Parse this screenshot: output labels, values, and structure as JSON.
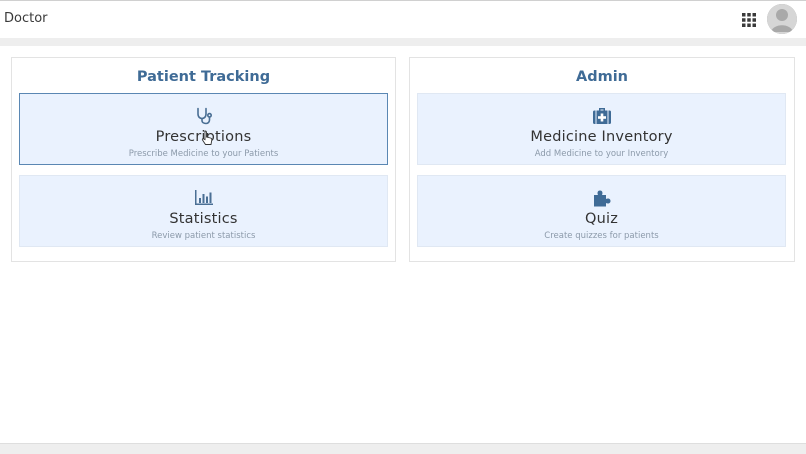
{
  "header": {
    "title": "Doctor",
    "apps_icon": "grid-apps-icon",
    "avatar_icon": "user-avatar-icon"
  },
  "colors": {
    "accent": "#3f6b96",
    "tile_bg": "#eaf2fe",
    "selected_border": "#5a87b3"
  },
  "panels": [
    {
      "title": "Patient Tracking",
      "tiles": [
        {
          "label": "Prescriptions",
          "sub": "Prescribe Medicine to your Patients",
          "icon": "stethoscope-icon",
          "selected": true
        },
        {
          "label": "Statistics",
          "sub": "Review patient statistics",
          "icon": "bar-chart-icon",
          "selected": false
        }
      ]
    },
    {
      "title": "Admin",
      "tiles": [
        {
          "label": "Medicine Inventory",
          "sub": "Add Medicine to your Inventory",
          "icon": "medical-kit-icon",
          "selected": false
        },
        {
          "label": "Quiz",
          "sub": "Create quizzes for patients",
          "icon": "puzzle-icon",
          "selected": false
        }
      ]
    }
  ]
}
